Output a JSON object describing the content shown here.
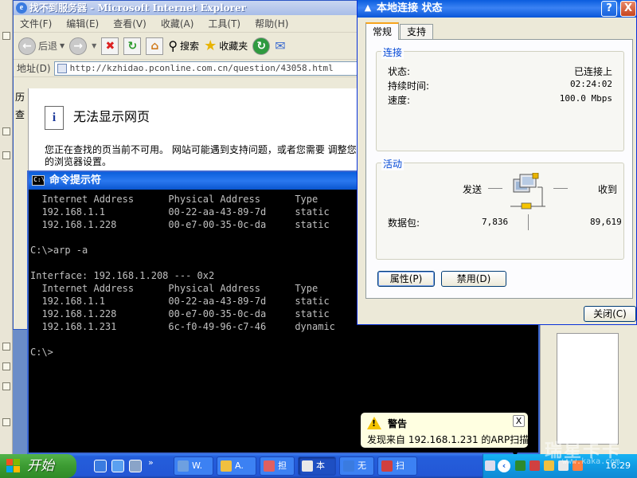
{
  "ie": {
    "title": "找不到服务器 - Microsoft Internet Explorer",
    "menu": [
      "文件(F)",
      "编辑(E)",
      "查看(V)",
      "收藏(A)",
      "工具(T)",
      "帮助(H)"
    ],
    "toolbar": {
      "back": "后退",
      "search": "搜索",
      "favorites": "收藏夹"
    },
    "address_label": "地址(D)",
    "url": "http://kzhidao.pconline.com.cn/question/43058.html",
    "left_nav": [
      "历",
      "查"
    ],
    "heading": "无法显示网页",
    "paragraph": "您正在查找的页当前不可用。 网站可能遇到支持问题，或者您需要 调整您的浏览器设置。"
  },
  "cmd": {
    "title": "命令提示符",
    "lines": [
      "  Internet Address      Physical Address      Type",
      "  192.168.1.1           00-22-aa-43-89-7d     static",
      "  192.168.1.228         00-e7-00-35-0c-da     static",
      "",
      "C:\\>arp -a",
      "",
      "Interface: 192.168.1.208 --- 0x2",
      "  Internet Address      Physical Address      Type",
      "  192.168.1.1           00-22-aa-43-89-7d     static",
      "  192.168.1.228         00-e7-00-35-0c-da     static",
      "  192.168.1.231         6c-f0-49-96-c7-46     dynamic",
      "",
      "C:\\>"
    ]
  },
  "dialog": {
    "title": "本地连接 状态",
    "help": "?",
    "close_x": "X",
    "tabs": [
      "常规",
      "支持"
    ],
    "connection": {
      "legend": "连接",
      "status_label": "状态:",
      "status_value": "已连接上",
      "duration_label": "持续时间:",
      "duration_value": "02:24:02",
      "speed_label": "速度:",
      "speed_value": "100.0 Mbps"
    },
    "activity": {
      "legend": "活动",
      "sent_label": "发送",
      "received_label": "收到",
      "packets_label": "数据包:",
      "sent_packets": "7,836",
      "received_packets": "89,619"
    },
    "properties_button": "属性(P)",
    "disable_button": "禁用(D)",
    "close_button": "关闭(C)"
  },
  "balloon": {
    "title": "警告",
    "text": "发现来自 192.168.1.231 的ARP扫描",
    "close": "X"
  },
  "taskbar": {
    "start": "开始",
    "tasks": [
      "W.",
      "A.",
      "担",
      "本",
      "无",
      "扫"
    ],
    "clock": "16:29"
  },
  "watermark": {
    "main": "瑞星卡卡",
    "sub": "www.kaka.com"
  },
  "colors": {
    "xp_blue": "#245edb",
    "start_green": "#3c9b32",
    "tray_blue": "#119be3",
    "balloon_bg": "#ffffe1"
  }
}
